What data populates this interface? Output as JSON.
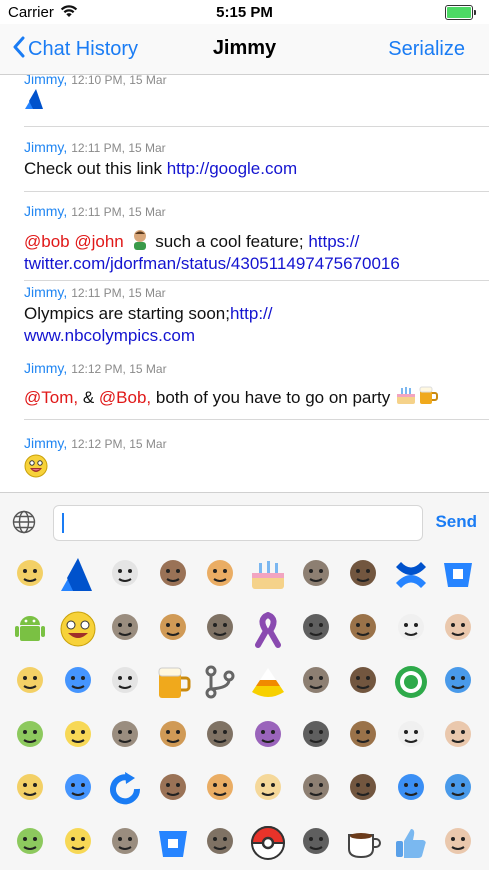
{
  "status": {
    "carrier": "Carrier",
    "time": "5:15 PM"
  },
  "nav": {
    "back_label": "Chat History",
    "title": "Jimmy",
    "action_label": "Serialize"
  },
  "messages": [
    {
      "sender": "Jimmy,",
      "meta": "12:10 PM, 15 Mar",
      "icon": "atlassian-emoticon"
    },
    {
      "sender": "Jimmy,",
      "meta": "12:11 PM, 15 Mar",
      "text": "Check out this link ",
      "link": "http://google.com"
    },
    {
      "sender": "Jimmy,",
      "meta": "12:11 PM, 15 Mar",
      "mention1": "@bob",
      "mention2": "@john",
      "emoticon": "baby-emoticon",
      "text": " such a cool feature; ",
      "link1": "https://",
      "link2": "twitter.com/jdorfman/status/430511497475670016"
    },
    {
      "sender": "Jimmy,",
      "meta": "12:11 PM, 15 Mar",
      "text": "Olympics are starting soon;",
      "link1": "http://",
      "link2": "www.nbcolympics.com"
    },
    {
      "sender": "Jimmy,",
      "meta": "12:12 PM, 15 Mar",
      "mention1": "@Tom,",
      "amp": " & ",
      "mention2": "@Bob,",
      "text": " both of you have to go on party ",
      "emoticons": [
        "cake-emoticon",
        "beer-emoticon"
      ]
    },
    {
      "sender": "Jimmy,",
      "meta": "12:12 PM, 15 Mar",
      "icon": "lol-face-emoticon"
    }
  ],
  "composer": {
    "value": "",
    "send_label": "Send"
  },
  "emoticon_grid": [
    "cheer",
    "atlassian",
    "hipster",
    "table-flip",
    "boom",
    "cake",
    "doge",
    "chewie",
    "confluence",
    "bitbucket-blue",
    "android",
    "awthanks",
    "basking-shark",
    "basket",
    "borat",
    "ribbon",
    "ninja",
    "rabbit",
    "content",
    "lady-face",
    "meh",
    "challenge",
    "poker",
    "beer",
    "branch",
    "candycorn",
    "gangnam",
    "butt",
    "target",
    "cool",
    "face",
    "cry",
    "boy",
    "muscle",
    "yeti",
    "hand-guy",
    "omg",
    "chuck",
    "cookie",
    "dog-glasses",
    "kid",
    "duck",
    "refresh",
    "flex",
    "bunny",
    "cooldude",
    "thinking",
    "man",
    "cloud",
    "guy",
    "person",
    "sketch",
    "baking-soda",
    "bucket",
    "badge",
    "pokeball",
    "bell",
    "coffee",
    "thumbs",
    "homer"
  ],
  "colors": {
    "accent": "#1a7cf4",
    "sender": "#2186f2",
    "mention": "#e01818",
    "link": "#1414d0"
  }
}
